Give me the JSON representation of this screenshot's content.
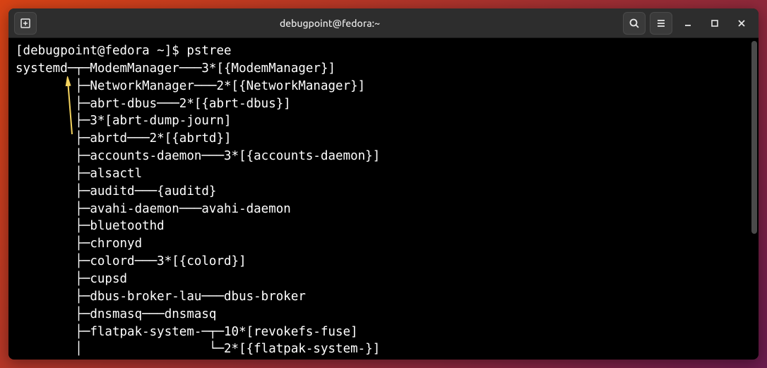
{
  "titlebar": {
    "title": "debugpoint@fedora:~"
  },
  "terminal": {
    "prompt": "[debugpoint@fedora ~]$ ",
    "command": "pstree",
    "lines": [
      "systemd─┬─ModemManager───3*[{ModemManager}]",
      "        ├─NetworkManager───2*[{NetworkManager}]",
      "        ├─abrt-dbus───2*[{abrt-dbus}]",
      "        ├─3*[abrt-dump-journ]",
      "        ├─abrtd───2*[{abrtd}]",
      "        ├─accounts-daemon───3*[{accounts-daemon}]",
      "        ├─alsactl",
      "        ├─auditd───{auditd}",
      "        ├─avahi-daemon───avahi-daemon",
      "        ├─bluetoothd",
      "        ├─chronyd",
      "        ├─colord───3*[{colord}]",
      "        ├─cupsd",
      "        ├─dbus-broker-lau───dbus-broker",
      "        ├─dnsmasq───dnsmasq",
      "        ├─flatpak-system-─┬─10*[revokefs-fuse]",
      "        │                 └─2*[{flatpak-system-}]"
    ]
  }
}
